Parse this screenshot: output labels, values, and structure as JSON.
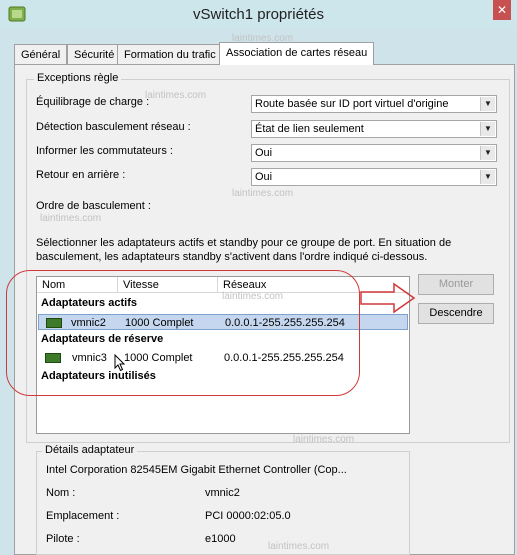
{
  "window": {
    "title": "vSwitch1 propriétés",
    "close_label": "✕"
  },
  "watermark": "laintimes.com",
  "tabs": [
    {
      "label": "Général"
    },
    {
      "label": "Sécurité"
    },
    {
      "label": "Formation du trafic"
    },
    {
      "label": "Association de cartes réseau",
      "active": true
    }
  ],
  "exceptions": {
    "legend": "Exceptions règle",
    "rows": [
      {
        "label": "Équilibrage de charge :",
        "value": "Route basée sur ID port virtuel d'origine"
      },
      {
        "label": "Détection basculement réseau :",
        "value": "État de lien seulement"
      },
      {
        "label": "Informer les commutateurs :",
        "value": "Oui"
      },
      {
        "label": "Retour en arrière :",
        "value": "Oui"
      }
    ],
    "failover_order_label": "Ordre de basculement :",
    "description": "Sélectionner les adaptateurs actifs et standby pour ce groupe de port. En situation de basculement, les adaptateurs standby s'activent dans l'ordre indiqué ci-dessous."
  },
  "adapter_list": {
    "columns": [
      "Nom",
      "Vitesse",
      "Réseaux"
    ],
    "groups": [
      {
        "title": "Adaptateurs actifs",
        "rows": [
          {
            "name": "vmnic2",
            "speed": "1000 Complet",
            "networks": "0.0.0.1-255.255.255.254",
            "selected": true
          }
        ]
      },
      {
        "title": "Adaptateurs de réserve",
        "rows": [
          {
            "name": "vmnic3",
            "speed": "1000 Complet",
            "networks": "0.0.0.1-255.255.255.254",
            "selected": false
          }
        ]
      },
      {
        "title": "Adaptateurs inutilisés",
        "rows": []
      }
    ]
  },
  "buttons": {
    "move_up": "Monter",
    "move_down": "Descendre"
  },
  "details": {
    "legend": "Détails adaptateur",
    "description": "Intel Corporation 82545EM Gigabit Ethernet Controller (Cop...",
    "fields": [
      {
        "label": "Nom :",
        "value": "vmnic2"
      },
      {
        "label": "Emplacement :",
        "value": "PCI 0000:02:05.0"
      },
      {
        "label": "Pilote :",
        "value": "e1000"
      }
    ]
  },
  "colors": {
    "annotation": "#d0393a",
    "selection": "#c4d7ef",
    "nic_icon": "#3d7a2a"
  }
}
